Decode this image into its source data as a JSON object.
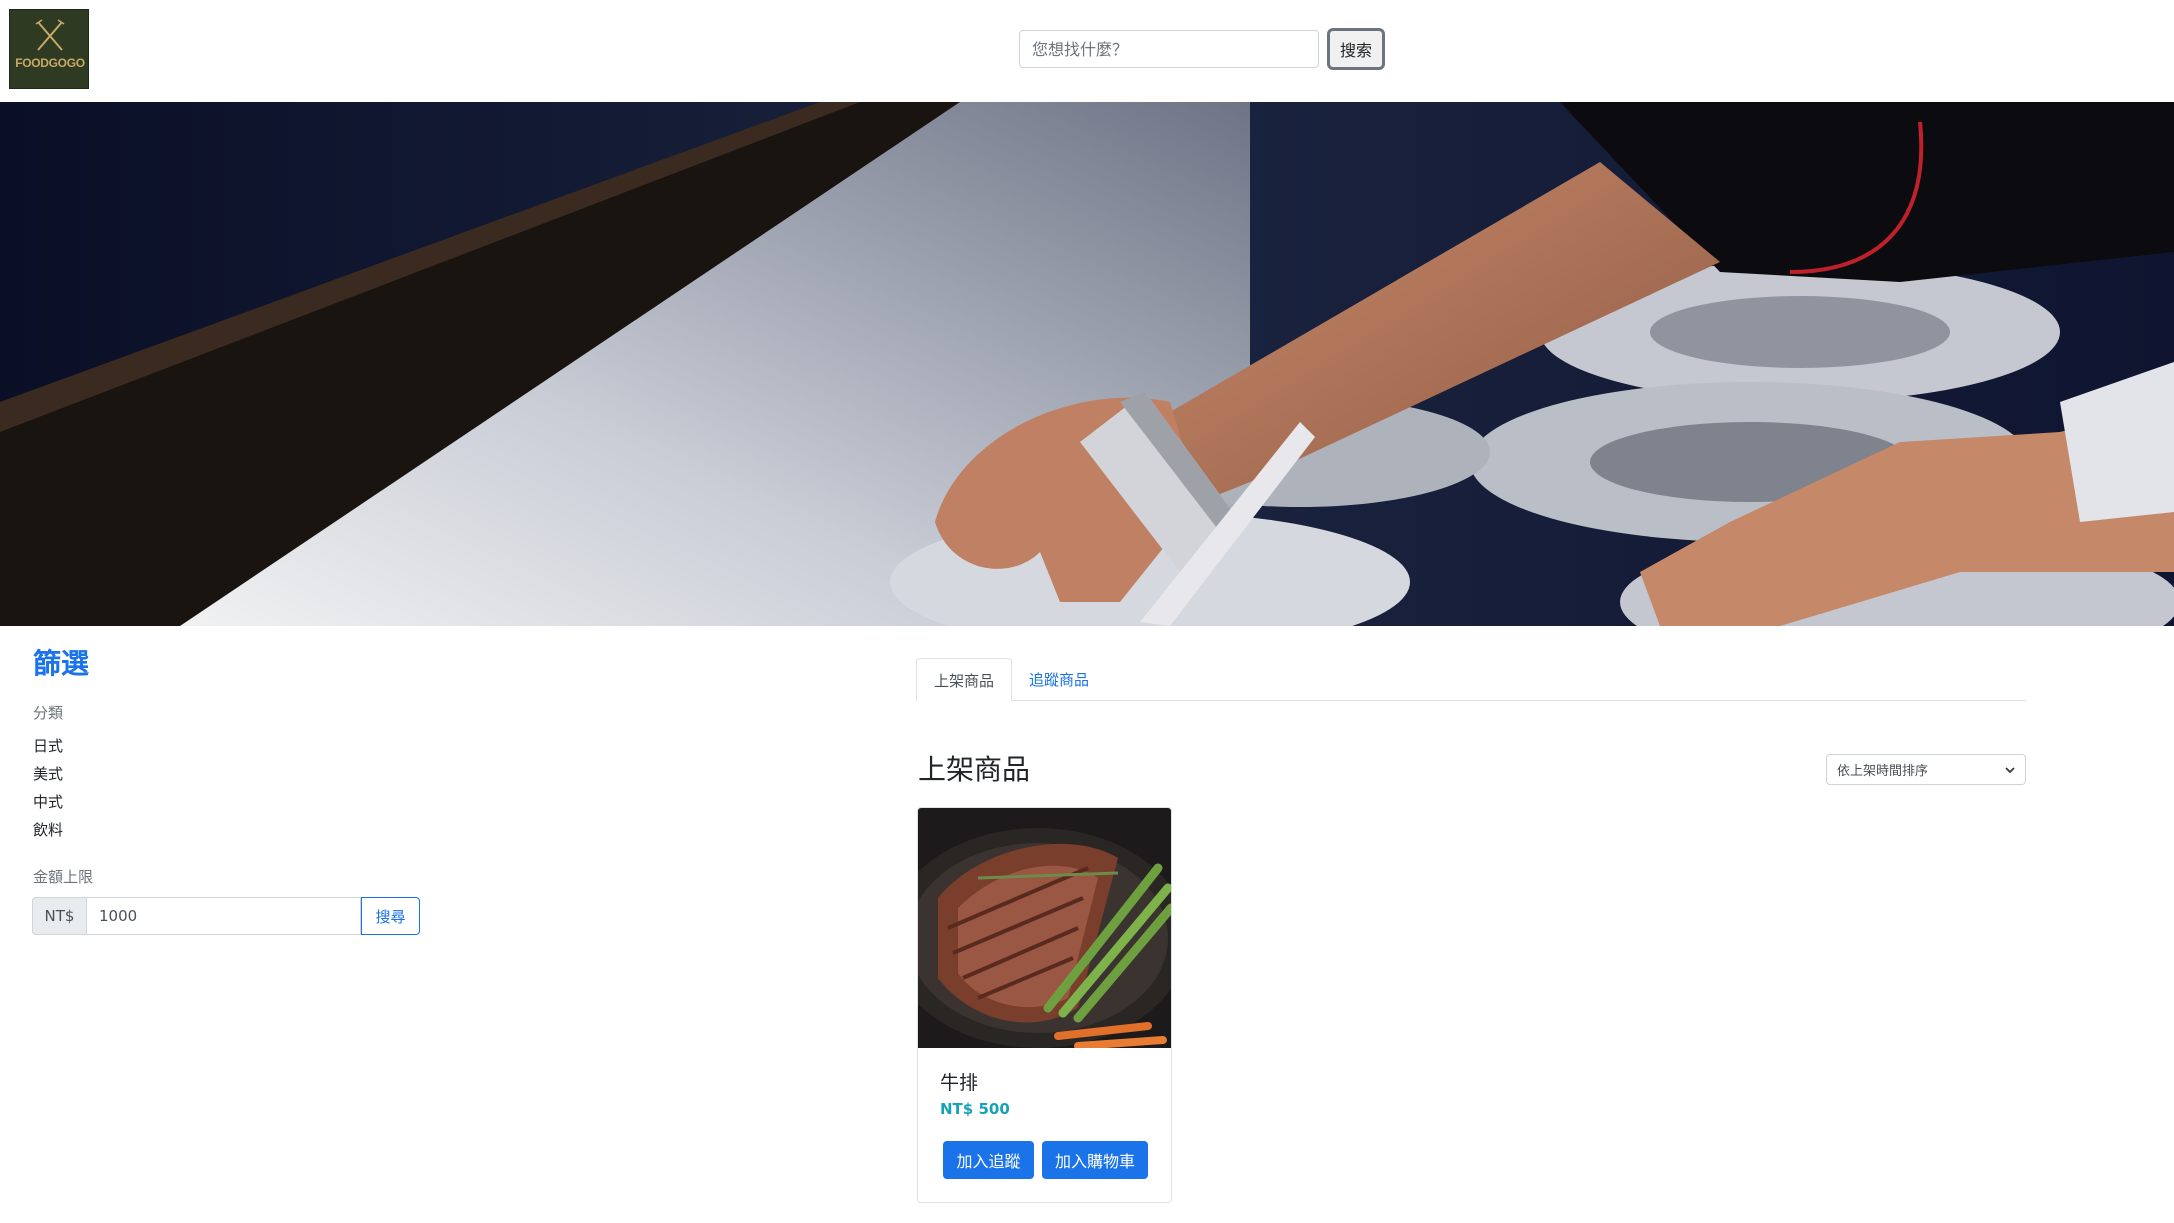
{
  "header": {
    "logo_text": "FOODGOGO",
    "search_placeholder": "您想找什麼？",
    "search_button": "搜索"
  },
  "filter": {
    "title": "篩選",
    "category_label": "分類",
    "categories": [
      "日式",
      "美式",
      "中式",
      "飲料"
    ],
    "price_label": "金額上限",
    "price_prefix": "NT$",
    "price_value": "1000",
    "price_button": "搜尋"
  },
  "tabs": [
    {
      "label": "上架商品",
      "active": true
    },
    {
      "label": "追蹤商品",
      "active": false
    }
  ],
  "main": {
    "section_title": "上架商品",
    "sort_selected": "依上架時間排序"
  },
  "products": [
    {
      "name": "牛排",
      "price": "NT$ 500",
      "track_button": "加入追蹤",
      "cart_button": "加入購物車"
    }
  ],
  "colors": {
    "accent": "#1a73e8",
    "price": "#17a2b8",
    "logo_bg": "#2e3b22"
  }
}
